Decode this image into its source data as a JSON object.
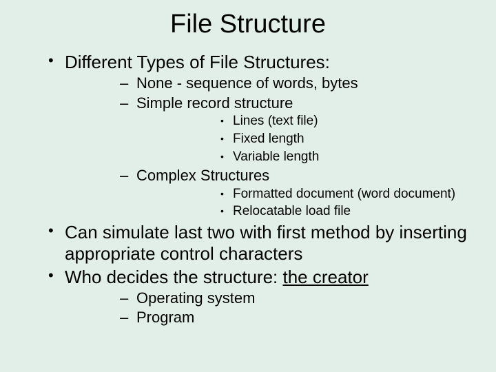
{
  "title": "File Structure",
  "b1": "Different Types of File Structures:",
  "b1_1": "None - sequence of words, bytes",
  "b1_2": "Simple record structure",
  "b1_2_1": "Lines (text file)",
  "b1_2_2": "Fixed length",
  "b1_2_3": "Variable length",
  "b1_3": "Complex Structures",
  "b1_3_1": "Formatted document  (word document)",
  "b1_3_2": "Relocatable load file",
  "b2": "Can simulate last two with first method by inserting appropriate control characters",
  "b3_pre": "Who decides the structure: ",
  "b3_underlined": "the creator",
  "b3_1": "Operating system",
  "b3_2": "Program"
}
